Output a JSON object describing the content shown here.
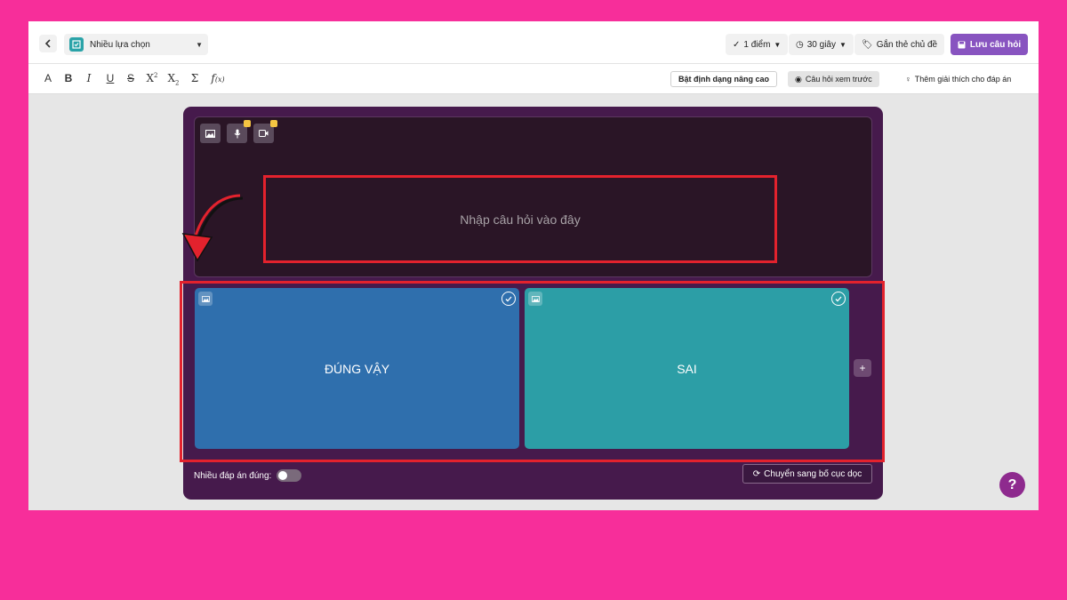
{
  "header": {
    "question_type": "Nhiều lựa chọn",
    "points": "1 điểm",
    "time": "30 giây",
    "tag": "Gắn thẻ chủ đề",
    "save": "Lưu câu hỏi"
  },
  "toolbar": {
    "advanced": "Bật định dạng nâng cao",
    "preview": "Câu hỏi xem trước",
    "explanation": "Thêm giải thích cho đáp án"
  },
  "question": {
    "placeholder": "Nhập câu hỏi vào đây"
  },
  "answers": [
    {
      "label": "ĐÚNG VẬY",
      "color": "#2f6fad"
    },
    {
      "label": "SAI",
      "color": "#2c9ea6"
    }
  ],
  "footer": {
    "multi_label": "Nhiều đáp án đúng:",
    "layout_btn": "Chuyển sang bố cục dọc"
  },
  "help": "?",
  "colors": {
    "page_bg": "#f72e9a",
    "accent": "#8854c0",
    "card": "#461a4c",
    "highlight": "#e3222d"
  }
}
